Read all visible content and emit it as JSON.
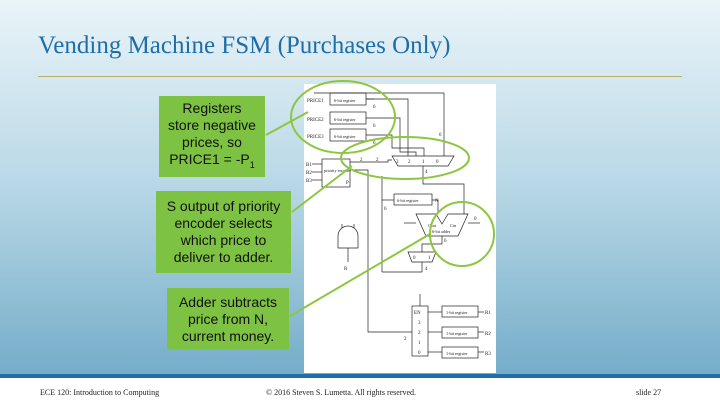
{
  "slide": {
    "title": "Vending Machine FSM (Purchases Only)",
    "footer": {
      "course": "ECE 120: Introduction to Computing",
      "copyright": "© 2016 Steven S. Lumetta.  All rights reserved.",
      "slide_number": "slide 27"
    }
  },
  "callouts": {
    "registers": {
      "line1": "Registers",
      "line2": "store negative",
      "line3": "prices, so",
      "line4_prefix": "PRICE1 = -P",
      "line4_sub": "1"
    },
    "priority": {
      "line1": "S output of priority",
      "line2": "encoder selects",
      "line3": "which price to",
      "line4": "deliver to adder."
    },
    "adder": {
      "line1": "Adder subtracts",
      "line2": "price from N,",
      "line3": "current money."
    }
  },
  "circuit": {
    "price_labels": [
      "PRICE1",
      "PRICE2",
      "PRICE3"
    ],
    "reg6": "6-bit register",
    "reg1": "1-bit register",
    "bus_width": "6",
    "two": "2",
    "four": "4",
    "mux_inputs": [
      "3",
      "2",
      "1",
      "0"
    ],
    "b_labels": [
      "B1",
      "B2",
      "B3"
    ],
    "encoder": "priority encoder",
    "p_label": "P",
    "n_label": "N",
    "r_label": "R",
    "adder_label": "6-bit adder",
    "cout": "Cout",
    "cin": "Cin",
    "mux2_inputs": [
      "0",
      "1"
    ],
    "en": "EN",
    "decoder_outputs": [
      "3",
      "2",
      "1",
      "0"
    ],
    "r_outputs": [
      "R1",
      "R2",
      "R3"
    ]
  },
  "colors": {
    "title": "#1f6ea8",
    "callout_fill": "#7dc242",
    "circle_stroke": "#8dc63f",
    "footer_bar": "#1f6ea8"
  }
}
